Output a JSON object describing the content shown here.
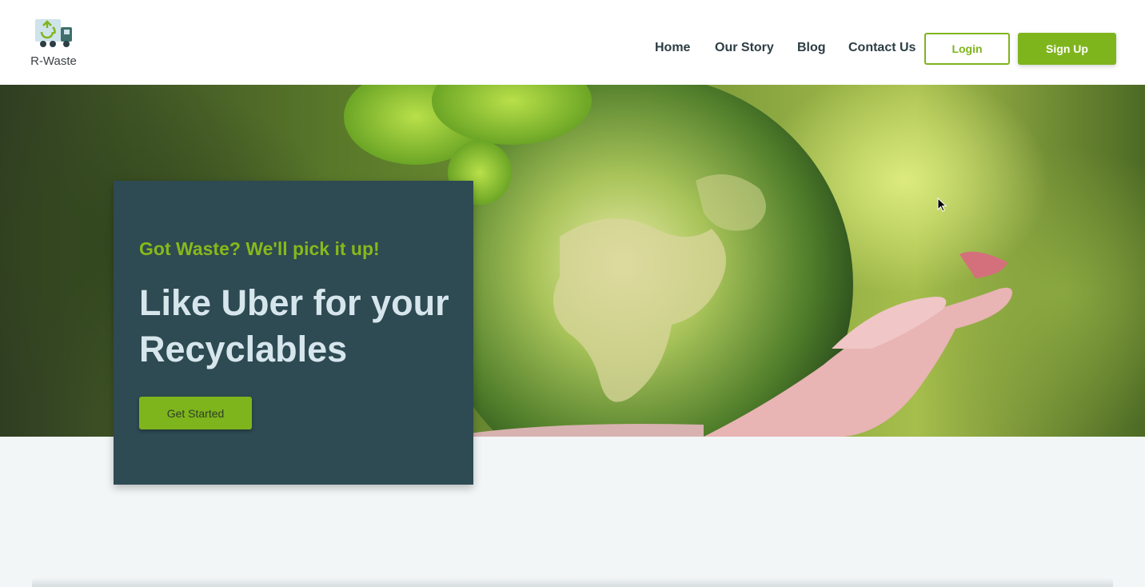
{
  "brand": {
    "name": "R-Waste",
    "logo_icon": "recycle-truck-icon"
  },
  "nav": {
    "items": [
      {
        "label": "Home"
      },
      {
        "label": "Our Story"
      },
      {
        "label": "Blog"
      },
      {
        "label": "Contact Us"
      }
    ],
    "login_label": "Login",
    "signup_label": "Sign Up"
  },
  "hero": {
    "tagline": "Got Waste? We'll pick it up!",
    "title": "Like Uber for your Recyclables",
    "cta_label": "Get Started",
    "image": "green-earth-globe-in-hand"
  },
  "colors": {
    "accent": "#7fb51c",
    "card": "#2e4a52",
    "title_text": "#d6e6ec",
    "nav_text": "#2d3e44"
  }
}
